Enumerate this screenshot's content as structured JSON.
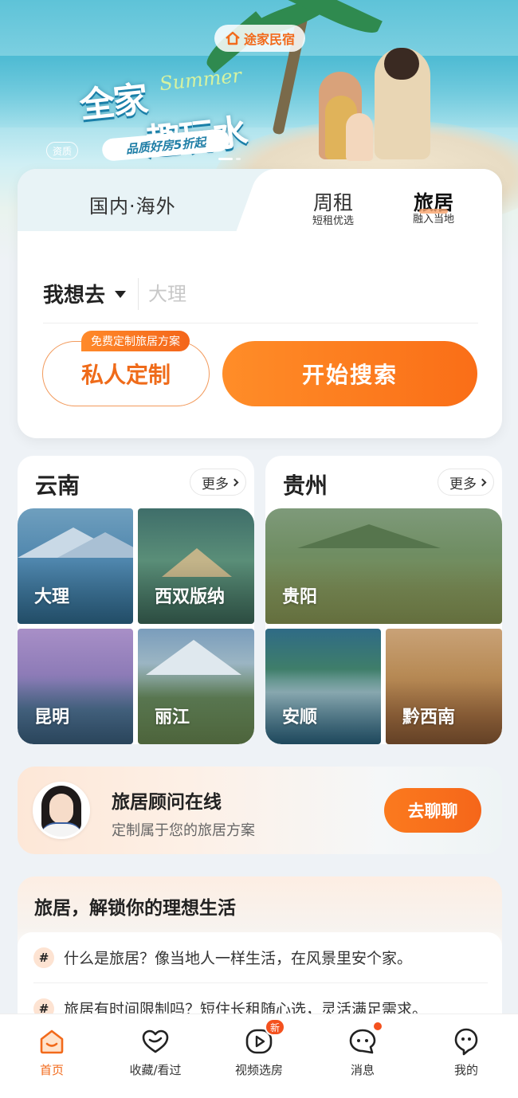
{
  "banner": {
    "brand": "途家民宿",
    "title_line1": "全家",
    "title_line2": "趣玩水",
    "script_word": "Summer",
    "subtitle": "品质好房5折起",
    "qualification": "资质"
  },
  "search": {
    "tab_main": "国内·海外",
    "tabs": [
      {
        "title": "周租",
        "sub": "短租优选"
      },
      {
        "title": "旅居",
        "sub": "融入当地"
      }
    ],
    "dest_label": "我想去",
    "dest_placeholder": "大理",
    "custom_tag": "免费定制旅居方案",
    "custom_button": "私人定制",
    "search_button": "开始搜索"
  },
  "regions": [
    {
      "name": "云南",
      "more": "更多",
      "cities": [
        "大理",
        "西双版纳",
        "昆明",
        "丽江"
      ]
    },
    {
      "name": "贵州",
      "more": "更多",
      "cities": [
        "贵阳",
        "安顺",
        "黔西南"
      ]
    }
  ],
  "advisor": {
    "title": "旅居顾问在线",
    "subtitle": "定制属于您的旅居方案",
    "button": "去聊聊"
  },
  "faq": {
    "title": "旅居，解锁你的理想生活",
    "items": [
      "什么是旅居？像当地人一样生活，在风景里安个家。",
      "旅居有时间限制吗？短住长租随心选，灵活满足需求。"
    ]
  },
  "tabbar": {
    "items": [
      "首页",
      "收藏/看过",
      "视频选房",
      "消息",
      "我的"
    ],
    "new_badge": "新"
  },
  "colors": {
    "accent": "#F26A1B",
    "accent_light": "#FF8D28"
  }
}
